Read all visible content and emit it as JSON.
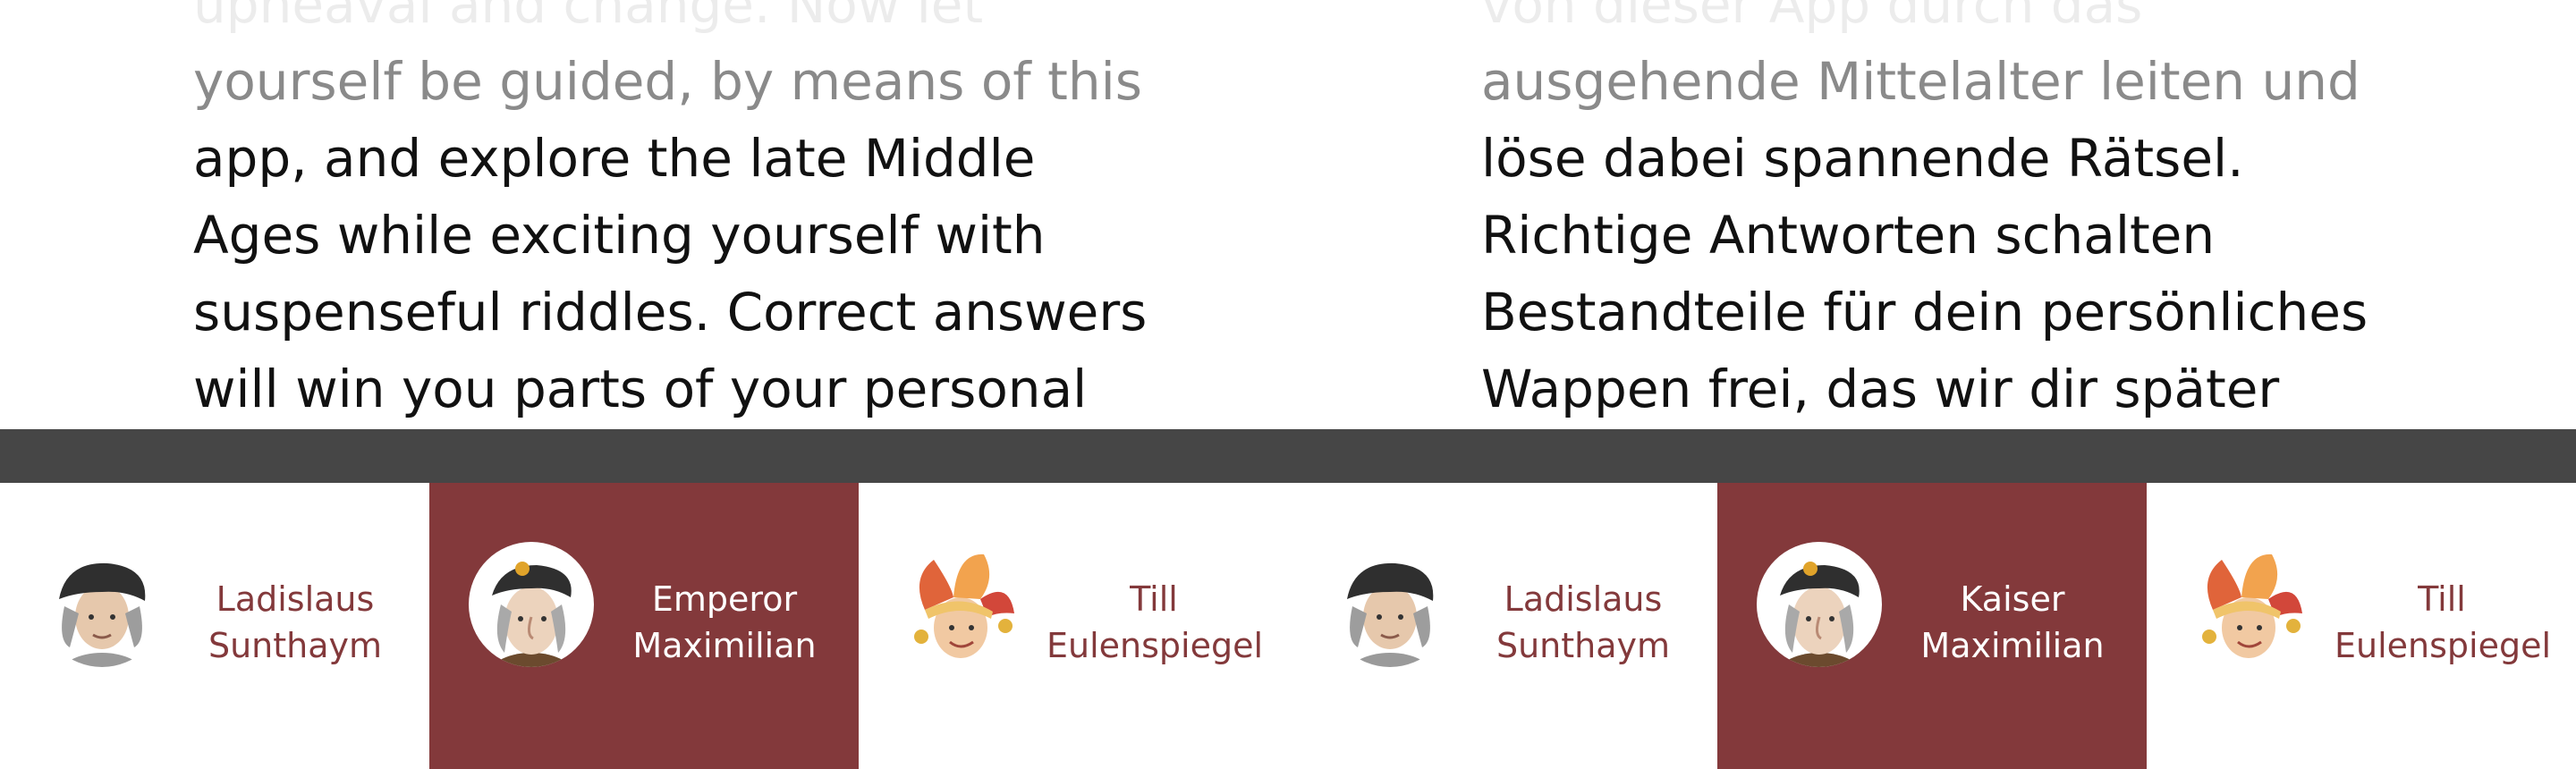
{
  "intro": {
    "english_lines": [
      "upheaval and change. Now let",
      "yourself be guided, by means of this",
      "app, and explore the late Middle",
      "Ages while exciting yourself with",
      "suspenseful riddles. Correct answers",
      "will win you parts of your personal"
    ],
    "german_lines": [
      "von dieser App durch das",
      "ausgehende Mittelalter leiten und",
      "löse dabei spannende Rätsel.",
      "Richtige Antworten schalten",
      "Bestandteile für dein persönliches",
      "Wappen frei, das wir dir später"
    ]
  },
  "characters": [
    {
      "first": "Ladislaus",
      "last": "Sunthaym",
      "icon": "scholar-portrait-icon",
      "active": false
    },
    {
      "first": "Emperor",
      "last": "Maximilian",
      "icon": "emperor-portrait-icon",
      "active": true
    },
    {
      "first": "Till",
      "last": "Eulenspiegel",
      "icon": "jester-portrait-icon",
      "active": false
    },
    {
      "first": "Ladislaus",
      "last": "Sunthaym",
      "icon": "scholar-portrait-icon",
      "active": false
    },
    {
      "first": "Kaiser",
      "last": "Maximilian",
      "icon": "emperor-portrait-icon",
      "active": true
    },
    {
      "first": "Till",
      "last": "Eulenspiegel",
      "icon": "jester-portrait-icon",
      "active": false
    }
  ],
  "colors": {
    "accent": "#83393b",
    "divider": "#464646",
    "text": "#111111",
    "faded_text": "#8a8a8a"
  }
}
